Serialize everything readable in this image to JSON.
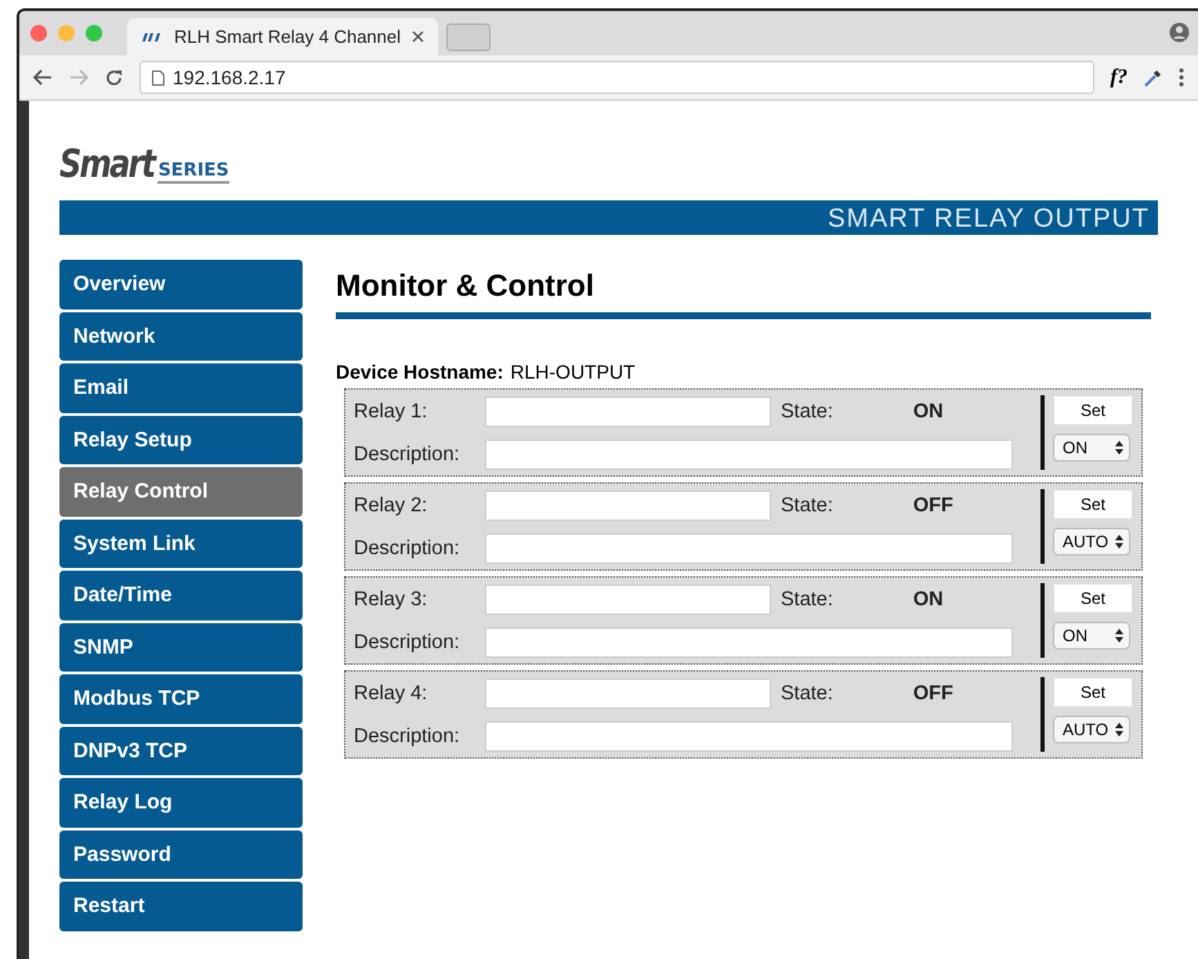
{
  "browser": {
    "tab_title": "RLH Smart Relay 4 Channel",
    "address": "192.168.2.17",
    "toolbar_text": "f?"
  },
  "logo": {
    "main": "Smart",
    "sub": "SERIES"
  },
  "banner": "SMART RELAY OUTPUT",
  "nav": [
    {
      "label": "Overview",
      "selected": false
    },
    {
      "label": "Network",
      "selected": false
    },
    {
      "label": "Email",
      "selected": false
    },
    {
      "label": "Relay Setup",
      "selected": false
    },
    {
      "label": "Relay Control",
      "selected": true
    },
    {
      "label": "System Link",
      "selected": false
    },
    {
      "label": "Date/Time",
      "selected": false
    },
    {
      "label": "SNMP",
      "selected": false
    },
    {
      "label": "Modbus TCP",
      "selected": false
    },
    {
      "label": "DNPv3 TCP",
      "selected": false
    },
    {
      "label": "Relay Log",
      "selected": false
    },
    {
      "label": "Password",
      "selected": false
    },
    {
      "label": "Restart",
      "selected": false
    }
  ],
  "heading": "Monitor & Control",
  "hostname": {
    "label": "Device Hostname:",
    "value": "RLH-OUTPUT"
  },
  "relays": [
    {
      "label": "Relay 1:",
      "state_label": "State:",
      "state": "ON",
      "description_label": "Description:",
      "set_button": "Set",
      "mode": "ON"
    },
    {
      "label": "Relay 2:",
      "state_label": "State:",
      "state": "OFF",
      "description_label": "Description:",
      "set_button": "Set",
      "mode": "AUTO"
    },
    {
      "label": "Relay 3:",
      "state_label": "State:",
      "state": "ON",
      "description_label": "Description:",
      "set_button": "Set",
      "mode": "ON"
    },
    {
      "label": "Relay 4:",
      "state_label": "State:",
      "state": "OFF",
      "description_label": "Description:",
      "set_button": "Set",
      "mode": "AUTO"
    }
  ]
}
